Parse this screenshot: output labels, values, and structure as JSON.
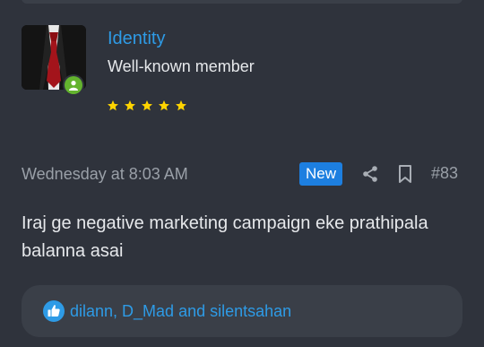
{
  "user": {
    "name": "Identity",
    "title": "Well-known member",
    "stars": 5,
    "online": true,
    "avatar_icon": "suit-tie-avatar"
  },
  "post": {
    "date": "Wednesday at 8:03 AM",
    "new_badge": "New",
    "number": "#83",
    "message": "Iraj ge negative marketing campaign eke prathipala balanna asai",
    "actions": [
      "share-icon",
      "bookmark-icon"
    ]
  },
  "reactions": {
    "icon": "like-icon",
    "users_text": "dilann, D_Mad and silentsahan"
  },
  "colors": {
    "background": "#2f333c",
    "panel": "#3a3f48",
    "link": "#2e9be6",
    "badge": "#1d7fe0",
    "star": "#ffd400",
    "online": "#63b32e",
    "muted": "#9aa0a8",
    "text": "#e6e8eb"
  }
}
